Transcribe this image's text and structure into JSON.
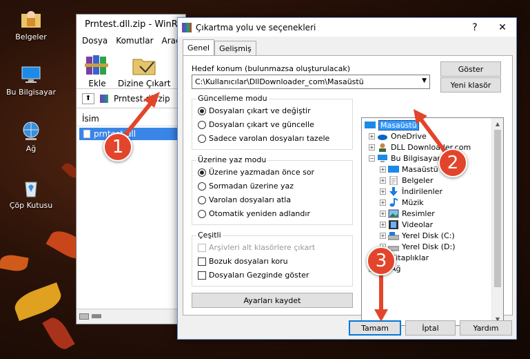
{
  "desktop": {
    "icons": [
      {
        "label": "Belgeler"
      },
      {
        "label": "Bu Bilgisayar"
      },
      {
        "label": "Ağ"
      },
      {
        "label": "Çöp Kutusu"
      }
    ]
  },
  "winrar": {
    "title": "Prntest.dll.zip - WinRAR",
    "menu": [
      "Dosya",
      "Komutlar",
      "Araçlar"
    ],
    "toolbar": {
      "add_label": "Ekle",
      "extract_label": "Dizine Çıkart"
    },
    "path": "Prntest.dll.zip",
    "column_name": "İsim",
    "file_row": "prntest.dll"
  },
  "dialog": {
    "title": "Çıkartma yolu ve seçenekleri",
    "help_glyph": "?",
    "close_glyph": "✕",
    "tabs": [
      "Genel",
      "Gelişmiş"
    ],
    "target_label": "Hedef konum (bulunmazsa oluşturulacak)",
    "target_value": "C:\\Kullanıcılar\\DllDownloader_com\\Masaüstü",
    "show_button": "Göster",
    "new_folder_button": "Yeni klasör",
    "update_mode": {
      "title": "Güncelleme modu",
      "options": [
        "Dosyaları çıkart ve değiştir",
        "Dosyaları çıkart ve güncelle",
        "Sadece varolan dosyaları tazele"
      ],
      "selected": 0
    },
    "overwrite_mode": {
      "title": "Üzerine yaz modu",
      "options": [
        "Üzerine yazmadan önce sor",
        "Sormadan üzerine yaz",
        "Varolan dosyaları atla",
        "Otomatik yeniden adlandır"
      ],
      "selected": 0
    },
    "misc": {
      "title": "Çeşitli",
      "options": [
        "Arşivleri alt klasörlere çıkart",
        "Bozuk dosyaları koru",
        "Dosyaları Gezginde göster"
      ],
      "disabled": [
        true,
        false,
        false
      ]
    },
    "save_settings_button": "Ayarları kaydet",
    "tree": [
      {
        "label": "Masaüstü"
      },
      {
        "label": "OneDrive"
      },
      {
        "label": "DLL Downloader.com"
      },
      {
        "label": "Bu Bilgisayar"
      },
      {
        "label": "Masaüstü"
      },
      {
        "label": "Belgeler"
      },
      {
        "label": "İndirilenler"
      },
      {
        "label": "Müzik"
      },
      {
        "label": "Resimler"
      },
      {
        "label": "Videolar"
      },
      {
        "label": "Yerel Disk (C:)"
      },
      {
        "label": "Yerel Disk (D:)"
      },
      {
        "label": "Kitaplıklar"
      },
      {
        "label": "Ağ"
      }
    ],
    "ok_button": "Tamam",
    "cancel_button": "İptal",
    "help_button": "Yardım"
  },
  "markers": [
    "1",
    "2",
    "3"
  ],
  "colors": {
    "marker": "#e3452c",
    "selection": "#3399ff",
    "accent": "#0078d7"
  }
}
